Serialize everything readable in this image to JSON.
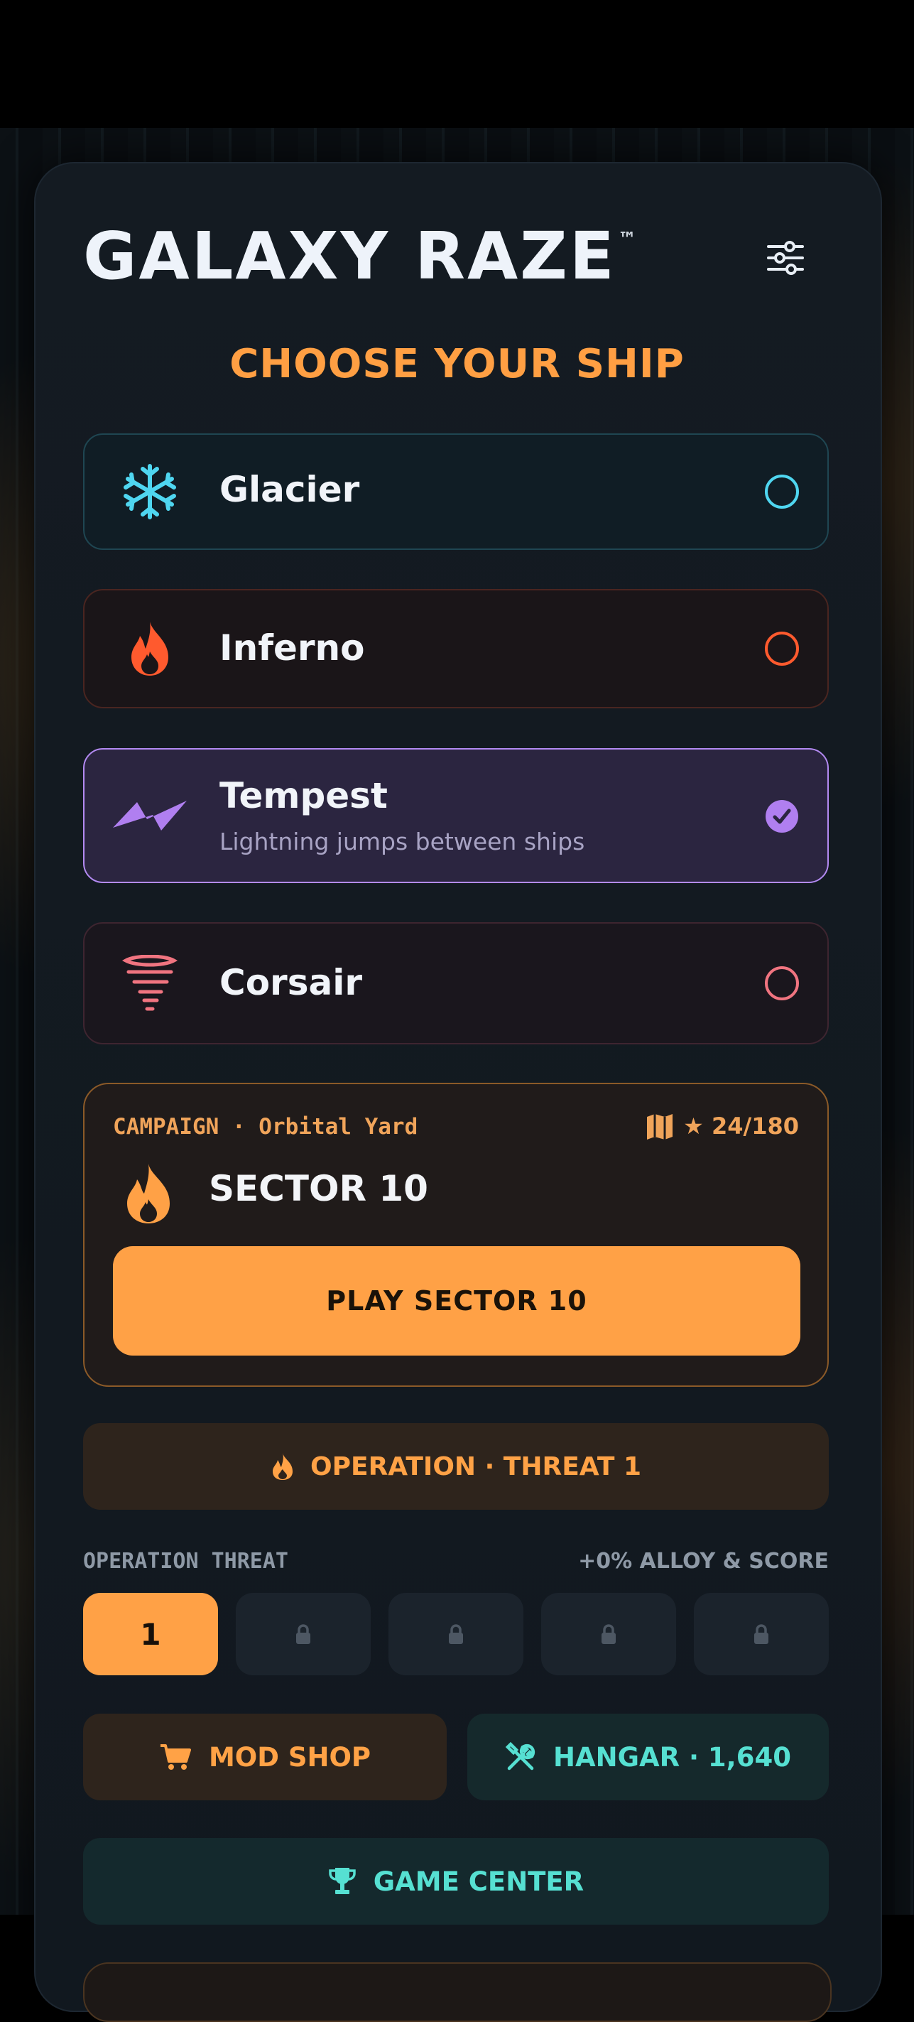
{
  "app": {
    "title": "GALAXY RAZE",
    "trademark": "™",
    "subtitle": "CHOOSE YOUR SHIP"
  },
  "ships": [
    {
      "name": "Glacier",
      "icon": "snowflake-icon",
      "color": "#4fd6f0",
      "selected": false
    },
    {
      "name": "Inferno",
      "icon": "fire-icon",
      "color": "#ff5a2e",
      "selected": false
    },
    {
      "name": "Tempest",
      "icon": "lightning-icon",
      "color": "#a87af0",
      "selected": true,
      "description": "Lightning jumps between ships"
    },
    {
      "name": "Corsair",
      "icon": "tornado-icon",
      "color": "#f07480",
      "selected": false
    }
  ],
  "campaign": {
    "label": "CAMPAIGN · Orbital Yard",
    "stars": "24/180",
    "sector": "SECTOR 10",
    "play_label": "PLAY SECTOR 10"
  },
  "operation": {
    "button_label": "OPERATION · THREAT 1",
    "threat_label": "OPERATION THREAT",
    "bonus": "+0% ALLOY & SCORE",
    "tiers": [
      {
        "label": "1",
        "locked": false
      },
      {
        "label": "",
        "locked": true
      },
      {
        "label": "",
        "locked": true
      },
      {
        "label": "",
        "locked": true
      },
      {
        "label": "",
        "locked": true
      }
    ]
  },
  "buttons": {
    "mod_shop": "MOD SHOP",
    "hangar": "HANGAR · 1,640",
    "game_center": "GAME CENTER"
  },
  "colors": {
    "accent": "#ffa146",
    "teal": "#56e0d2",
    "selected": "#b38af2"
  }
}
